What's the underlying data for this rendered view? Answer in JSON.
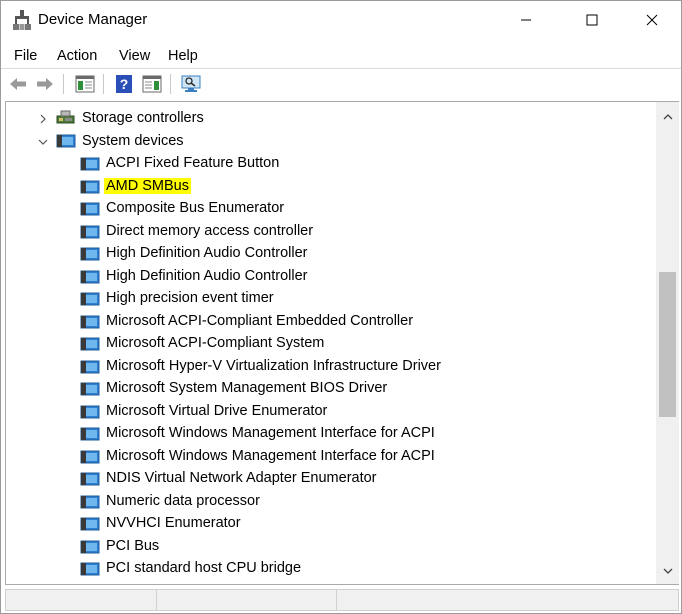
{
  "window": {
    "title": "Device Manager"
  },
  "menu": {
    "items": [
      "File",
      "Action",
      "View",
      "Help"
    ]
  },
  "toolbar": {
    "icons": [
      "back-arrow-icon",
      "forward-arrow-icon",
      "show-hide-console-tree-icon",
      "help-icon",
      "action-pane-icon",
      "scan-hardware-icon"
    ]
  },
  "tree": {
    "categories": [
      {
        "label": "Storage controllers",
        "expanded": false
      },
      {
        "label": "System devices",
        "expanded": true
      }
    ],
    "devices": [
      "ACPI Fixed Feature Button",
      "AMD SMBus",
      "Composite Bus Enumerator",
      "Direct memory access controller",
      "High Definition Audio Controller",
      "High Definition Audio Controller",
      "High precision event timer",
      "Microsoft ACPI-Compliant Embedded Controller",
      "Microsoft ACPI-Compliant System",
      "Microsoft Hyper-V Virtualization Infrastructure Driver",
      "Microsoft System Management BIOS Driver",
      "Microsoft Virtual Drive Enumerator",
      "Microsoft Windows Management Interface for ACPI",
      "Microsoft Windows Management Interface for ACPI",
      "NDIS Virtual Network Adapter Enumerator",
      "Numeric data processor",
      "NVVHCI Enumerator",
      "PCI Bus",
      "PCI standard host CPU bridge"
    ],
    "highlighted_device": "AMD SMBus",
    "highlight_color": "#ffff00"
  }
}
